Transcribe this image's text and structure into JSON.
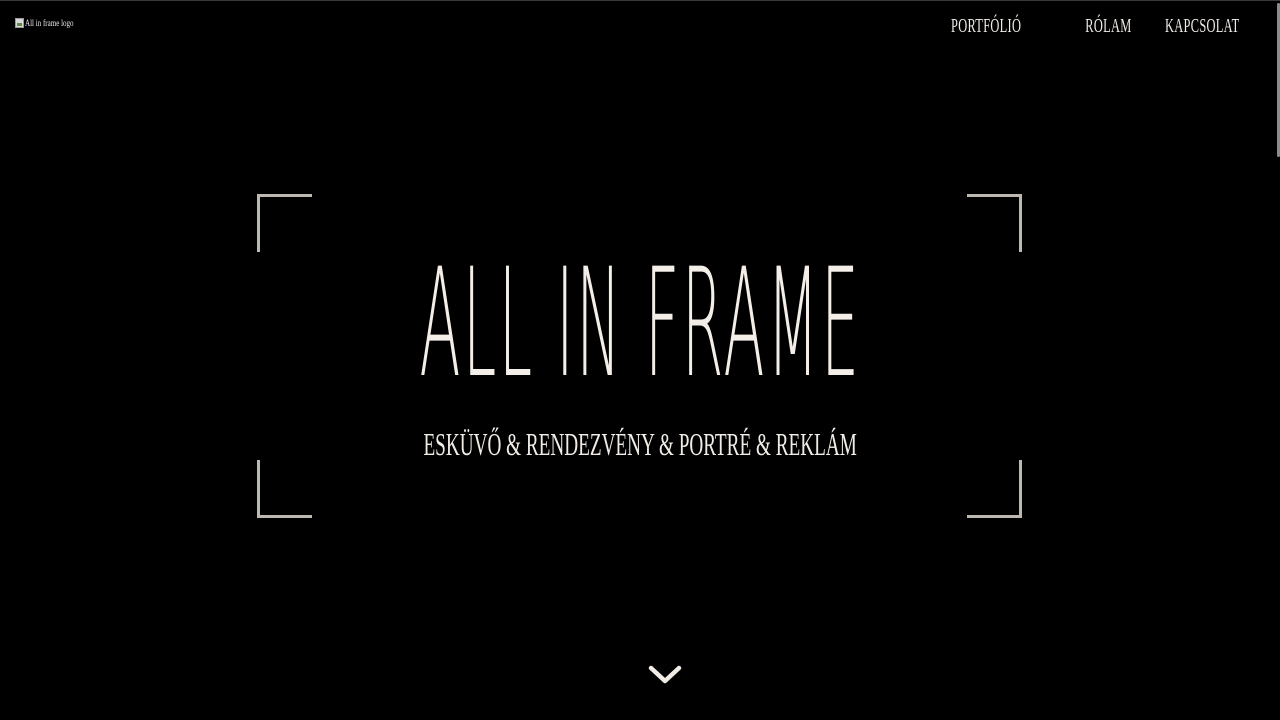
{
  "logo": {
    "alt_text": "All in frame logo"
  },
  "nav": {
    "items": [
      {
        "label": "Portfólió"
      },
      {
        "label": "Rólam"
      },
      {
        "label": "Kapcsolat"
      }
    ]
  },
  "hero": {
    "title": "ALL IN FRAME",
    "subtitle": "ESKÜVŐ & RENDEZVÉNY & PORTRÉ & REKLÁM"
  },
  "icons": {
    "scroll": "chevron-down-icon",
    "logo": "broken-image-icon"
  },
  "colors": {
    "background": "#000000",
    "text": "#f1ece6",
    "frame": "#bdb8b2"
  }
}
